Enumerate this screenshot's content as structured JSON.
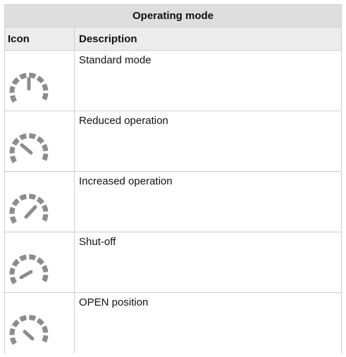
{
  "table": {
    "title": "Operating mode",
    "headers": {
      "icon": "Icon",
      "description": "Description"
    },
    "rows": [
      {
        "icon": "gauge-standard-icon",
        "needle": "up",
        "description": "Standard mode"
      },
      {
        "icon": "gauge-reduced-icon",
        "needle": "down-left",
        "description": "Reduced operation"
      },
      {
        "icon": "gauge-increased-icon",
        "needle": "up-right",
        "description": "Increased operation"
      },
      {
        "icon": "gauge-shutoff-icon",
        "needle": "left",
        "description": "Shut-off"
      },
      {
        "icon": "gauge-open-icon",
        "needle": "down-right",
        "description": "OPEN position"
      }
    ]
  },
  "colors": {
    "title_background": "#dedede",
    "header_background": "#ececec",
    "border": "#cfcfcf",
    "icon_gray": "#8c8c8c"
  }
}
